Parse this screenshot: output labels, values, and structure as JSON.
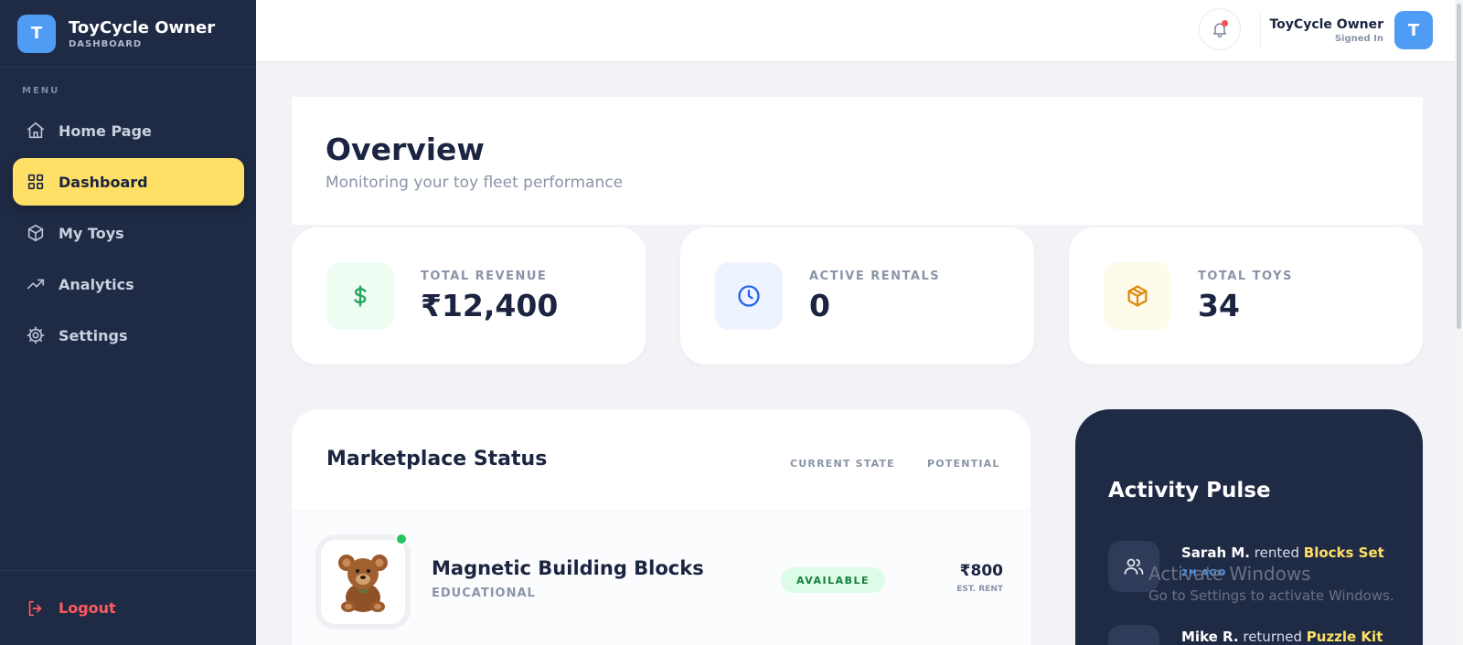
{
  "brand": {
    "logo_letter": "T",
    "title": "ToyCycle Owner",
    "subtitle": "DASHBOARD"
  },
  "sidebar": {
    "menu_label": "MENU",
    "items": [
      {
        "label": "Home Page",
        "icon": "home-icon"
      },
      {
        "label": "Dashboard",
        "icon": "grid-icon",
        "active": true
      },
      {
        "label": "My Toys",
        "icon": "box-icon"
      },
      {
        "label": "Analytics",
        "icon": "trending-up-icon"
      },
      {
        "label": "Settings",
        "icon": "gear-icon"
      }
    ],
    "logout_label": "Logout"
  },
  "header": {
    "user_name": "ToyCycle Owner",
    "user_status": "Signed In",
    "avatar_letter": "T"
  },
  "overview": {
    "title": "Overview",
    "subtitle": "Monitoring your toy fleet performance"
  },
  "stats": [
    {
      "label": "TOTAL REVENUE",
      "value": "₹12,400",
      "icon": "dollar-icon",
      "color": "#22a55a",
      "bg": "#eefcf2"
    },
    {
      "label": "ACTIVE RENTALS",
      "value": "0",
      "icon": "clock-icon",
      "color": "#2563eb",
      "bg": "#eef4ff"
    },
    {
      "label": "TOTAL TOYS",
      "value": "34",
      "icon": "package-icon",
      "color": "#e08a12",
      "bg": "#fffbea"
    }
  ],
  "marketplace": {
    "title": "Marketplace Status",
    "columns": [
      "CURRENT STATE",
      "POTENTIAL"
    ],
    "rows": [
      {
        "name": "Magnetic Building Blocks",
        "category": "EDUCATIONAL",
        "status": "AVAILABLE",
        "price": "₹800",
        "price_label": "EST. RENT"
      }
    ]
  },
  "activity": {
    "title": "Activity Pulse",
    "items": [
      {
        "user": "Sarah M.",
        "action": "rented",
        "item": "Blocks Set",
        "time": "2H AGO"
      },
      {
        "user": "Mike R.",
        "action": "returned",
        "item": "Puzzle Kit"
      }
    ]
  },
  "watermark": {
    "line1": "Activate Windows",
    "line2": "Go to Settings to activate Windows."
  },
  "colors": {
    "sidebar_bg": "#1f2a44",
    "accent_yellow": "#ffe066",
    "brand_blue": "#4f9cf5",
    "danger": "#ff5a5f",
    "success": "#22c55e"
  }
}
